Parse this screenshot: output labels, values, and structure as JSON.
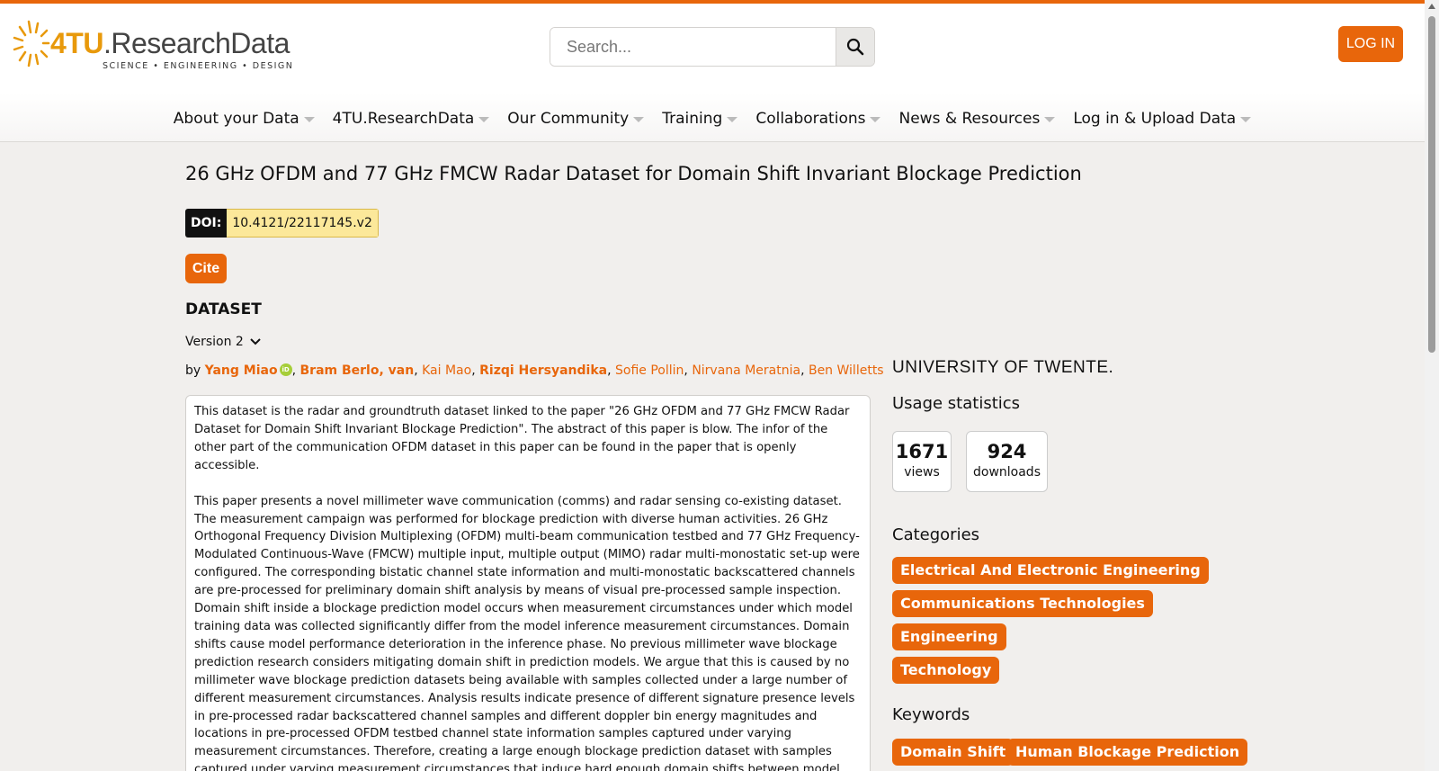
{
  "header": {
    "logo": {
      "brand_accent": "4TU",
      "brand_rest": ".ResearchData",
      "tagline": "SCIENCE • ENGINEERING • DESIGN"
    },
    "search": {
      "placeholder": "Search..."
    },
    "login_label": "LOG IN"
  },
  "nav": {
    "items": [
      {
        "label": "About your Data"
      },
      {
        "label": "4TU.ResearchData"
      },
      {
        "label": "Our Community"
      },
      {
        "label": "Training"
      },
      {
        "label": "Collaborations"
      },
      {
        "label": "News & Resources"
      },
      {
        "label": "Log in & Upload Data"
      }
    ]
  },
  "dataset": {
    "title": "26 GHz OFDM and 77 GHz FMCW Radar Dataset for Domain Shift Invariant Blockage Prediction",
    "doi_label": "DOI:",
    "doi": "10.4121/22117145.v2",
    "cite_label": "Cite",
    "type": "DATASET",
    "version": "Version 2",
    "by": "by",
    "authors": [
      {
        "name": "Yang Miao",
        "bold": true,
        "orcid": true
      },
      {
        "name": "Bram Berlo, van",
        "bold": true
      },
      {
        "name": "Kai Mao",
        "bold": false
      },
      {
        "name": "Rizqi Hersyandika",
        "bold": true
      },
      {
        "name": "Sofie Pollin",
        "bold": false
      },
      {
        "name": "Nirvana Meratnia",
        "bold": false
      },
      {
        "name": "Ben Willetts",
        "bold": false
      }
    ],
    "orcid_label": "iD",
    "description": [
      "This dataset is the radar and groundtruth dataset linked to the paper \"26 GHz OFDM and 77 GHz FMCW Radar Dataset for Domain Shift Invariant Blockage Prediction\". The abstract of this paper is blow. The infor of the other part of the communication OFDM dataset in this paper can be found in the paper that is openly accessible.",
      "This paper presents a novel millimeter wave communication (comms) and radar sensing co-existing dataset. The measurement campaign was performed for blockage prediction with diverse human activities. 26 GHz Orthogonal Frequency Division Multiplexing (OFDM) multi-beam communication testbed and 77 GHz Frequency-Modulated Continuous-Wave (FMCW) multiple input, multiple output (MIMO) radar multi-monostatic set-up were configured. The corresponding bistatic channel state information and multi-monostatic backscattered channels are pre-processed for preliminary domain shift analysis by means of visual pre-processed sample inspection. Domain shift inside a blockage prediction model occurs when measurement circumstances under which model training data was collected significantly differ from the model inference measurement circumstances. Domain shifts cause model performance deterioration in the inference phase. No previous millimeter wave blockage prediction research considers mitigating domain shift in prediction models. We argue that this is caused by no millimeter wave blockage prediction datasets being available with samples collected under a large number of different measurement circumstances. Analysis results indicate presence of different signature presence levels in pre-processed radar backscattered channel samples and different doppler bin energy magnitudes and locations in pre-processed OFDM testbed channel state information samples captured under varying measurement circumstances. Therefore, creating a large enough blockage prediction dataset with samples captured under varying measurement circumstances that induce hard enough domain shifts between model train and inference situations is important to allow model domain shift mitigation."
    ]
  },
  "sidebar": {
    "institution": "UNIVERSITY OF TWENTE.",
    "usage_heading": "Usage statistics",
    "stats": [
      {
        "value": "1671",
        "label": "views"
      },
      {
        "value": "924",
        "label": "downloads"
      }
    ],
    "categories_heading": "Categories",
    "categories": [
      "Electrical And Electronic Engineering",
      "Communications Technologies",
      "Engineering",
      "Technology"
    ],
    "keywords_heading": "Keywords",
    "keywords": [
      "Domain Shift",
      "Human Blockage Prediction"
    ]
  },
  "colors": {
    "accent": "#e8660b",
    "doi_bg": "#fce89a",
    "page_bg": "#f1efed",
    "logo_accent": "#e8990b"
  }
}
